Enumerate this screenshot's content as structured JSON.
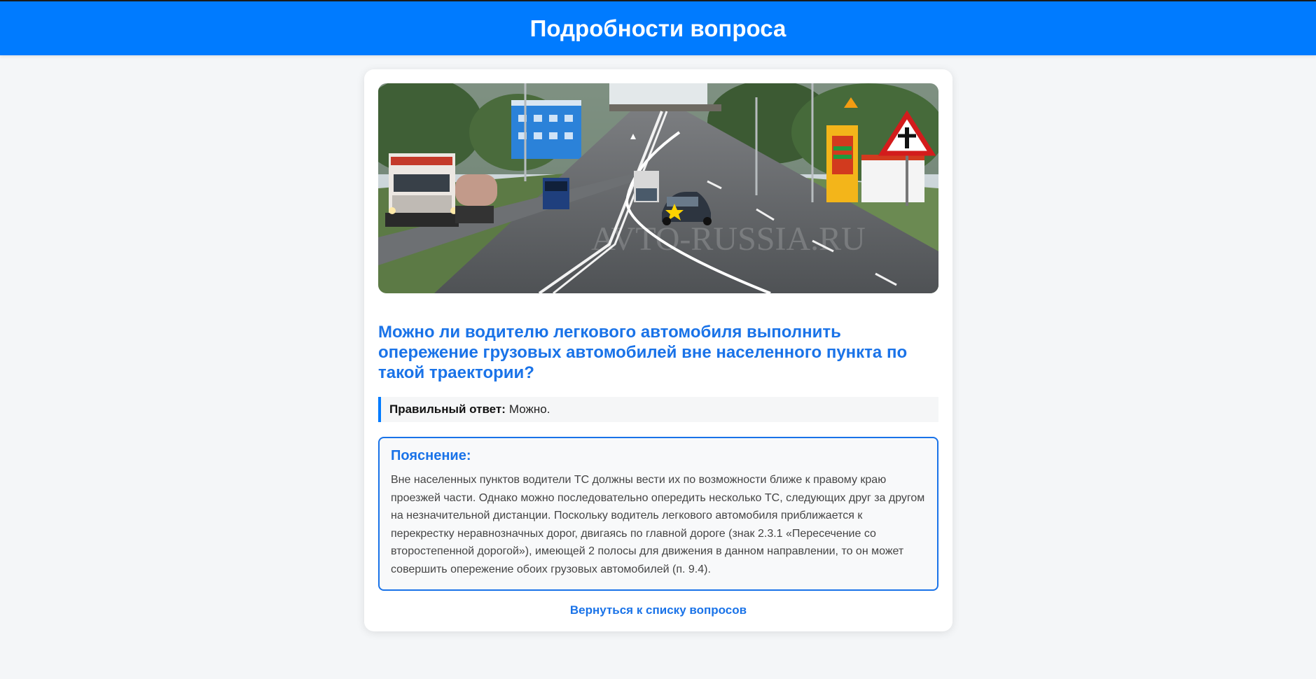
{
  "header": {
    "title": "Подробности вопроса"
  },
  "question": {
    "image_alt": "Дорога вне населенного пункта с грузовыми автомобилями и знаком 2.3.1",
    "image_watermark": "AVTO-RUSSIA.RU",
    "text": "Можно ли водителю легкового автомобиля выполнить опережение грузовых автомобилей вне населенного пункта по такой траектории?",
    "answer_label": "Правильный ответ:",
    "answer_value": "Можно."
  },
  "explanation": {
    "title": "Пояснение:",
    "text": "Вне населенных пунктов водители ТС должны вести их по возможности ближе к правому краю проезжей части. Однако можно последовательно опередить несколько ТС, следующих друг за другом на незначительной дистанции. Поскольку водитель легкового автомобиля приближается к перекрестку неравнозначных дорог, двигаясь по главной дороге (знак 2.3.1 «Пересечение со второстепенной дорогой»), имеющей 2 полосы для движения в данном направлении, то он может совершить опережение обоих грузовых автомобилей (п. 9.4)."
  },
  "navigation": {
    "back_label": "Вернуться к списку вопросов"
  },
  "colors": {
    "header_bg": "#007bff",
    "accent": "#1a73e8",
    "page_bg": "#f4f6f8"
  }
}
